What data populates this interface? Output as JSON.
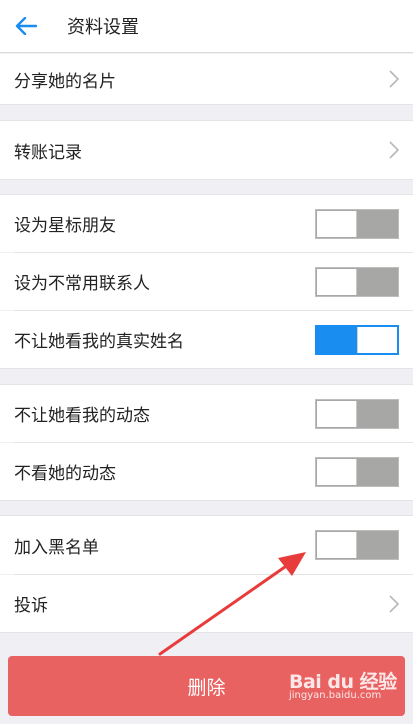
{
  "header": {
    "title": "资料设置"
  },
  "rows": {
    "share_card": {
      "label": "分享她的名片"
    },
    "transfer_records": {
      "label": "转账记录"
    },
    "star_friend": {
      "label": "设为星标朋友",
      "toggle_on": false
    },
    "infrequent_contact": {
      "label": "设为不常用联系人",
      "toggle_on": false
    },
    "hide_real_name": {
      "label": "不让她看我的真实姓名",
      "toggle_on": true
    },
    "hide_my_moments": {
      "label": "不让她看我的动态",
      "toggle_on": false
    },
    "hide_her_moments": {
      "label": "不看她的动态",
      "toggle_on": false
    },
    "blacklist": {
      "label": "加入黑名单",
      "toggle_on": false
    },
    "report": {
      "label": "投诉"
    }
  },
  "delete_button": {
    "label": "删除"
  },
  "watermark": {
    "logo": "Bai du 经验",
    "url": "jingyan.baidu.com"
  },
  "colors": {
    "accent": "#1a8ef0",
    "danger": "#e86262",
    "arrow": "#e83c3c",
    "background": "#efeff4"
  },
  "icons": {
    "back": "back-arrow-icon",
    "chevron": "chevron-right-icon"
  }
}
